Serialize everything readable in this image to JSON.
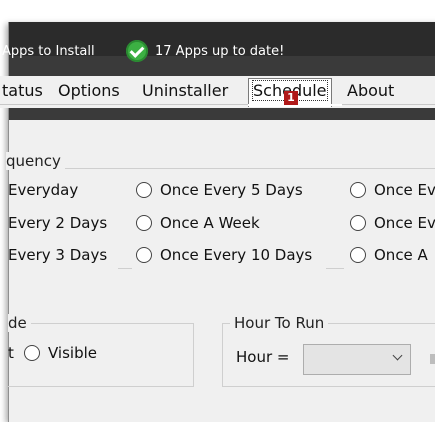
{
  "status": {
    "left_text": "Apps to Install",
    "right_text": "17 Apps up to date!"
  },
  "tabs": {
    "status": "tatus",
    "options": "Options",
    "uninstaller": "Uninstaller",
    "schedule": "Schedule",
    "about": "About",
    "active": "Schedule"
  },
  "badge": "1",
  "frequency": {
    "label": "quency",
    "options": [
      "Everyday",
      "Once Every 5 Days",
      "Once Ev",
      "Every 2 Days",
      "Once A Week",
      "Once Ev",
      "Every 3 Days",
      "Once Every 10 Days",
      "Once A"
    ]
  },
  "mode": {
    "label": "de",
    "left_option": "t",
    "visible_option": "Visible"
  },
  "hour_to_run": {
    "label": "Hour To Run",
    "hour_label": "Hour =",
    "hour_value": ""
  },
  "colors": {
    "titlebar": "#2b2b2b",
    "statusbar": "#3a3a3a",
    "badge": "#b01919",
    "check": "#3cb043"
  }
}
